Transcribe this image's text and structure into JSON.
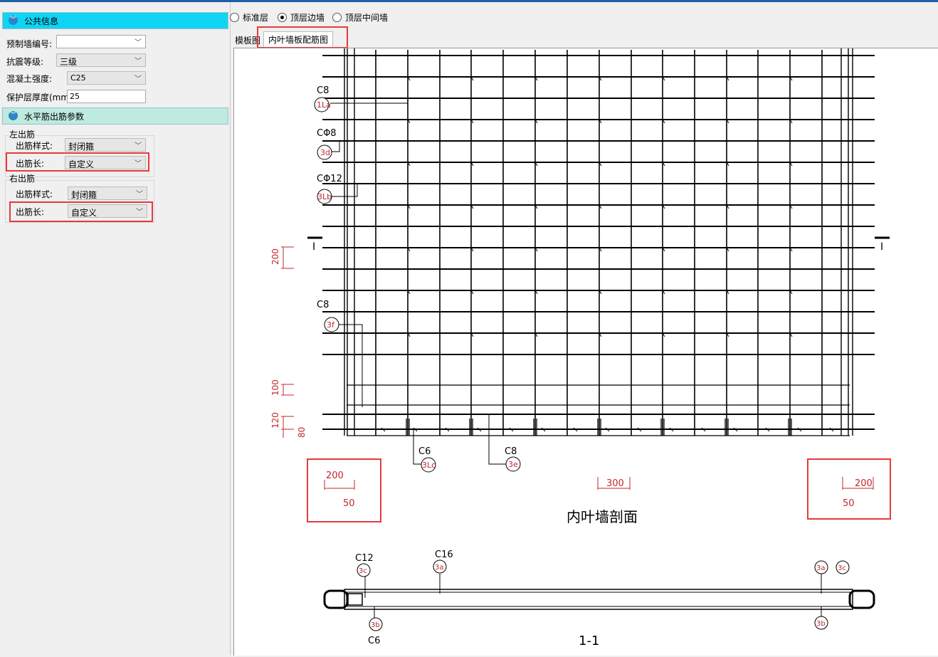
{
  "left_panel": {
    "public_section": {
      "title": "公共信息"
    },
    "fields": {
      "wall_id": {
        "label": "预制墙编号:",
        "value": ""
      },
      "seismic": {
        "label": "抗震等级:",
        "value": "三级"
      },
      "concrete": {
        "label": "混凝土强度:",
        "value": "C25"
      },
      "cover": {
        "label": "保护层厚度(mm)",
        "value": "25"
      }
    },
    "horizontal_section": {
      "title": "水平筋出筋参数"
    },
    "left_out": {
      "group_label": "左出筋",
      "style_label": "出筋样式:",
      "style_value": "封闭箍",
      "length_label": "出筋长:",
      "length_value": "自定义"
    },
    "right_out": {
      "group_label": "右出筋",
      "style_label": "出筋样式:",
      "style_value": "封闭箍",
      "length_label": "出筋长:",
      "length_value": "自定义"
    }
  },
  "radios": [
    {
      "label": "标准层",
      "selected": false
    },
    {
      "label": "顶层边墙",
      "selected": true
    },
    {
      "label": "顶层中间墙",
      "selected": false
    }
  ],
  "tabs": [
    {
      "label": "模板图",
      "active": false
    },
    {
      "label": "内叶墙板配筋图",
      "active": true
    }
  ],
  "drawing": {
    "callouts": {
      "c8_top": "C8",
      "tag_1la": "1La",
      "c8_phi": "CΦ8",
      "tag_3d": "3d",
      "c12_phi": "CΦ12",
      "tag_3l": "3Lb",
      "c8_mid": "C8",
      "tag_3f": "3f",
      "c6_bot": "C6",
      "tag_3lc": "3Lc",
      "c8_bot": "C8",
      "tag_3e": "3e"
    },
    "dims": {
      "d200_left": "200",
      "d100": "100",
      "d120": "120",
      "d80": "80",
      "bl_200": "200",
      "bl_50": "50",
      "mid_300": "300",
      "br_200": "200",
      "br_50": "50"
    },
    "section_mark": "I",
    "elevation_title": "内叶墙剖面",
    "plan": {
      "c12": "C12",
      "tag_3c_l": "3c",
      "c16": "C16",
      "tag_3a": "3a",
      "tag_3a_r": "3a",
      "tag_3c_r": "3c",
      "tag_3b_l": "3b",
      "c6": "C6",
      "tag_3b_r": "3b",
      "title": "1-1"
    }
  },
  "colors": {
    "accent": "#10d4f4",
    "section2": "#bdebde",
    "highlight": "#e8393c",
    "dim_red": "#c0282d"
  }
}
